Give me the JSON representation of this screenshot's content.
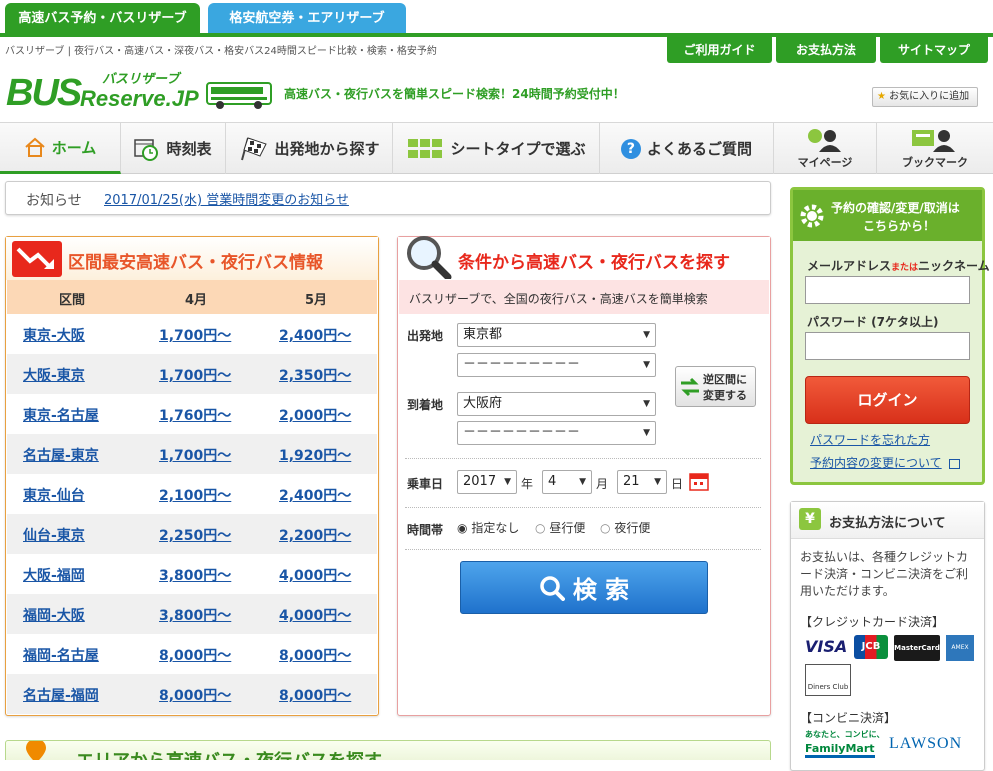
{
  "top_tabs": {
    "bus": "高速バス予約・バスリザーブ",
    "air": "格安航空券・エアリザーブ"
  },
  "header": {
    "breadcrumb": "バスリザーブ | 夜行バス・高速バス・深夜バス・格安バス24時間スピード比較・検索・格安予約",
    "logo_small": "バスリザーブ",
    "logo_big1": "BUS",
    "logo_big2": "Reserve.JP",
    "tagline": "高速バス・夜行バスを簡単スピード検索！24時間予約受付中！",
    "util": [
      "ご利用ガイド",
      "お支払方法",
      "サイトマップ"
    ],
    "favorite": "お気に入りに追加"
  },
  "nav": {
    "home": "ホーム",
    "timetable": "時刻表",
    "departure": "出発地から探す",
    "seat": "シートタイプで選ぶ",
    "faq": "よくあるご質問",
    "mypage": "マイページ",
    "bookmark": "ブックマーク"
  },
  "notice": {
    "label": "お知らせ",
    "text": "2017/01/25(水) 営業時間変更のお知らせ"
  },
  "fares": {
    "title": "区間最安高速バス・夜行バス情報",
    "headers": [
      "区間",
      "4月",
      "5月"
    ],
    "rows": [
      [
        "東京-大阪",
        "1,700円～",
        "2,400円～"
      ],
      [
        "大阪-東京",
        "1,700円～",
        "2,350円～"
      ],
      [
        "東京-名古屋",
        "1,760円～",
        "2,000円～"
      ],
      [
        "名古屋-東京",
        "1,700円～",
        "1,920円～"
      ],
      [
        "東京-仙台",
        "2,100円～",
        "2,400円～"
      ],
      [
        "仙台-東京",
        "2,250円～",
        "2,200円～"
      ],
      [
        "大阪-福岡",
        "3,800円～",
        "4,000円～"
      ],
      [
        "福岡-大阪",
        "3,800円～",
        "4,000円～"
      ],
      [
        "福岡-名古屋",
        "8,000円～",
        "8,000円～"
      ],
      [
        "名古屋-福岡",
        "8,000円～",
        "8,000円～"
      ]
    ]
  },
  "search": {
    "title": "条件から高速バス・夜行バスを探す",
    "subtitle": "バスリザーブで、全国の夜行バス・高速バスを簡単検索",
    "dep_label": "出発地",
    "dep_value": "東京都",
    "dep_sub": "－－－－－－－－－",
    "arr_label": "到着地",
    "arr_value": "大阪府",
    "arr_sub": "－－－－－－－－－",
    "swap1": "逆区間に",
    "swap2": "変更する",
    "date_label": "乗車日",
    "year": "2017",
    "year_unit": "年",
    "month": "4",
    "month_unit": "月",
    "day": "21",
    "day_unit": "日",
    "time_label": "時間帯",
    "time_opts": [
      "指定なし",
      "昼行便",
      "夜行便"
    ],
    "button": "検 索"
  },
  "login": {
    "header1": "予約の確認/変更/取消は",
    "header2": "こちらから！",
    "email_label1": "メールアドレス",
    "email_label_or": "または",
    "email_label2": "ニックネーム",
    "password_label": "パスワード (7ケタ以上)",
    "button": "ログイン",
    "forgot": "パスワードを忘れた方",
    "change": "予約内容の変更について"
  },
  "payment": {
    "title": "お支払方法について",
    "text": "お支払いは、各種クレジットカード決済・コンビニ決済をご利用いただけます。",
    "credit": "【クレジットカード決済】",
    "cards": [
      "VISA",
      "JCB",
      "MasterCard",
      "AMEX",
      "Diners Club"
    ],
    "conv": "【コンビニ決済】",
    "stores": [
      "FamilyMart",
      "LAWSON"
    ],
    "fm_slogan": "あなたと、コンビに、"
  },
  "area": {
    "title": "エリアから高速バス・夜行バスを探す"
  },
  "colors": {
    "green": "#2f9e25",
    "orange": "#f08a00",
    "red": "#e8281c",
    "blue": "#2f7fd6"
  }
}
